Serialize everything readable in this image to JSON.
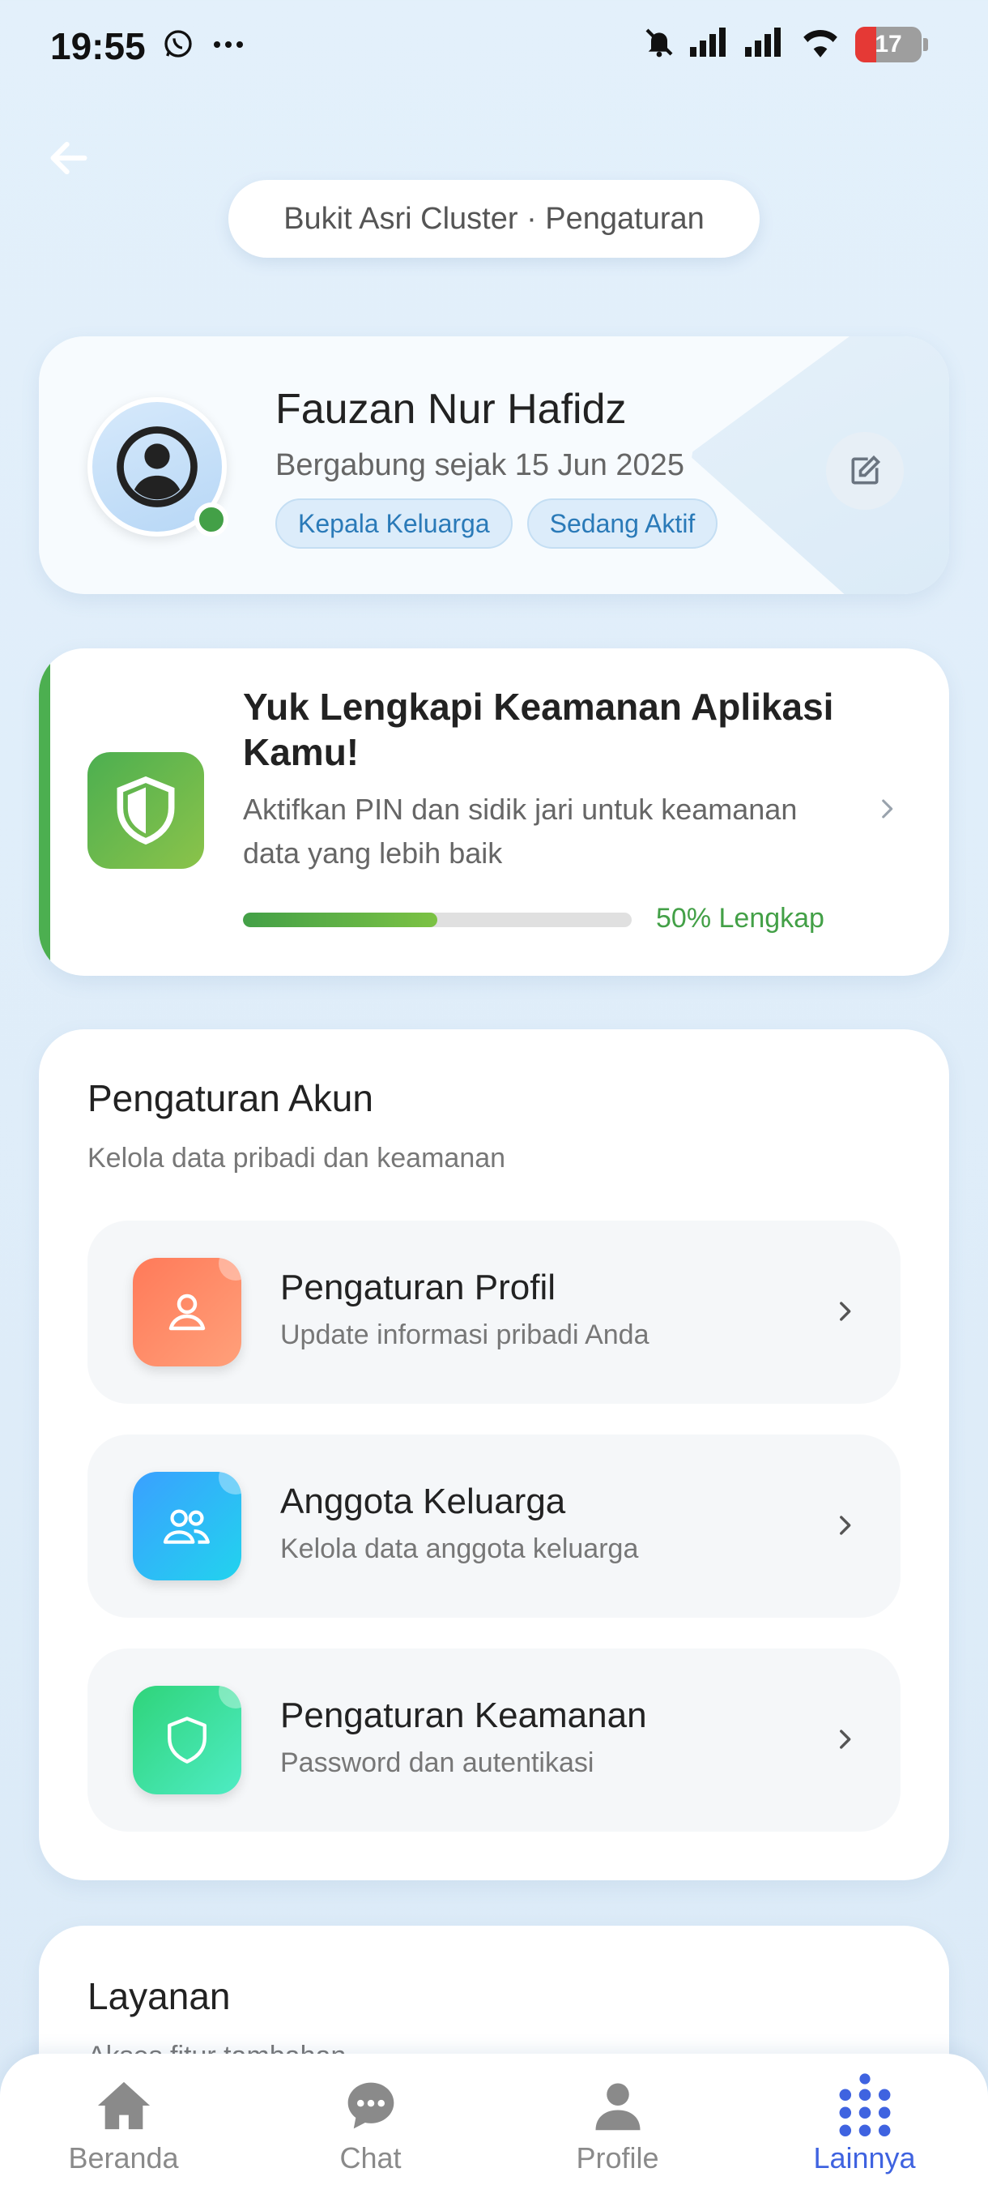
{
  "status_bar": {
    "time": "19:55",
    "battery": "17",
    "icons": [
      "whatsapp-icon",
      "more-dots-icon",
      "mute-bell-icon",
      "signal-icon",
      "signal-icon",
      "wifi-icon",
      "battery-icon"
    ]
  },
  "header": {
    "back_icon": "arrow-left-icon",
    "title": "Bukit Asri Cluster · Pengaturan"
  },
  "profile": {
    "name": "Fauzan Nur Hafidz",
    "joined": "Bergabung sejak 15 Jun 2025",
    "badges": [
      "Kepala Keluarga",
      "Sedang Aktif"
    ],
    "online_color": "#43a047",
    "edit_icon": "edit-icon"
  },
  "security_banner": {
    "title": "Yuk Lengkapi Keamanan Aplikasi Kamu!",
    "description": "Aktifkan PIN dan sidik jari untuk keamanan data yang lebih baik",
    "progress_percent": 50,
    "progress_label": "50% Lengkap",
    "accent_color": "#4caf50"
  },
  "account_settings": {
    "title": "Pengaturan Akun",
    "subtitle": "Kelola data pribadi dan keamanan",
    "items": [
      {
        "title": "Pengaturan Profil",
        "subtitle": "Update informasi pribadi Anda",
        "icon": "user-icon",
        "color": "#ff8a65"
      },
      {
        "title": "Anggota Keluarga",
        "subtitle": "Kelola data anggota keluarga",
        "icon": "users-icon",
        "color": "#29b6f6"
      },
      {
        "title": "Pengaturan Keamanan",
        "subtitle": "Password dan autentikasi",
        "icon": "shield-icon",
        "color": "#3ddc97"
      }
    ]
  },
  "services": {
    "title": "Layanan",
    "subtitle": "Akses fitur tambahan"
  },
  "bottom_nav": {
    "items": [
      {
        "label": "Beranda",
        "icon": "home-icon"
      },
      {
        "label": "Chat",
        "icon": "chat-icon"
      },
      {
        "label": "Profile",
        "icon": "person-icon"
      },
      {
        "label": "Lainnya",
        "icon": "grid-dots-icon",
        "active": true
      }
    ],
    "active_color": "#3f63e0"
  }
}
